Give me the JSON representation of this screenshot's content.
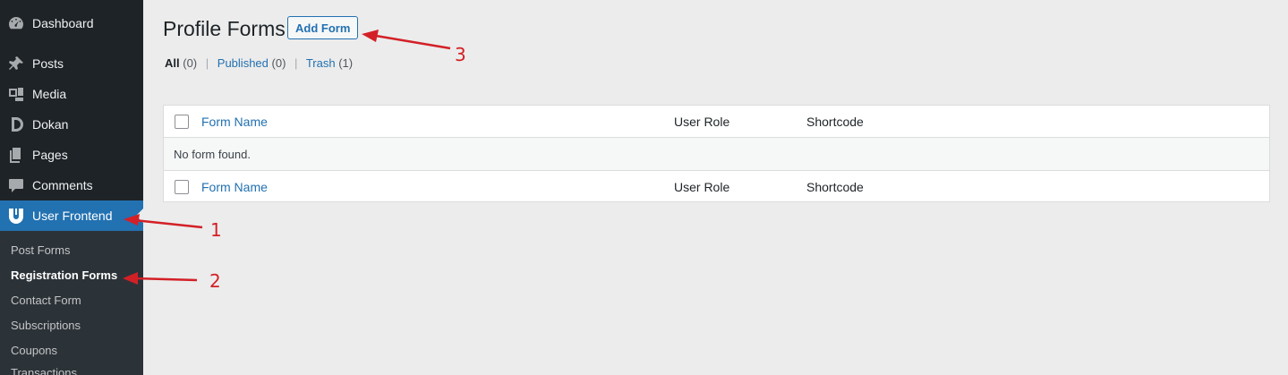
{
  "sidebar": {
    "items": [
      {
        "label": "Dashboard",
        "icon": "dashboard-icon"
      },
      {
        "label": "Posts",
        "icon": "pin-icon"
      },
      {
        "label": "Media",
        "icon": "media-icon"
      },
      {
        "label": "Dokan",
        "icon": "dokan-icon"
      },
      {
        "label": "Pages",
        "icon": "pages-icon"
      },
      {
        "label": "Comments",
        "icon": "comment-icon"
      },
      {
        "label": "User Frontend",
        "icon": "user-frontend-icon"
      }
    ],
    "submenu": [
      {
        "label": "Post Forms"
      },
      {
        "label": "Registration Forms"
      },
      {
        "label": "Contact Form"
      },
      {
        "label": "Subscriptions"
      },
      {
        "label": "Coupons"
      },
      {
        "label": "Transactions"
      }
    ]
  },
  "main": {
    "title": "Profile Forms",
    "add_button": "Add Form",
    "filters": [
      {
        "label": "All",
        "count": "(0)"
      },
      {
        "label": "Published",
        "count": "(0)"
      },
      {
        "label": "Trash",
        "count": "(1)"
      }
    ],
    "filter_separator": "|",
    "table": {
      "columns": [
        "Form Name",
        "User Role",
        "Shortcode"
      ],
      "empty_message": "No form found."
    }
  },
  "annotations": [
    "1",
    "2",
    "3"
  ],
  "colors": {
    "sidebar_bg": "#1d2327",
    "accent": "#2271b1",
    "annotation": "#d32027"
  }
}
